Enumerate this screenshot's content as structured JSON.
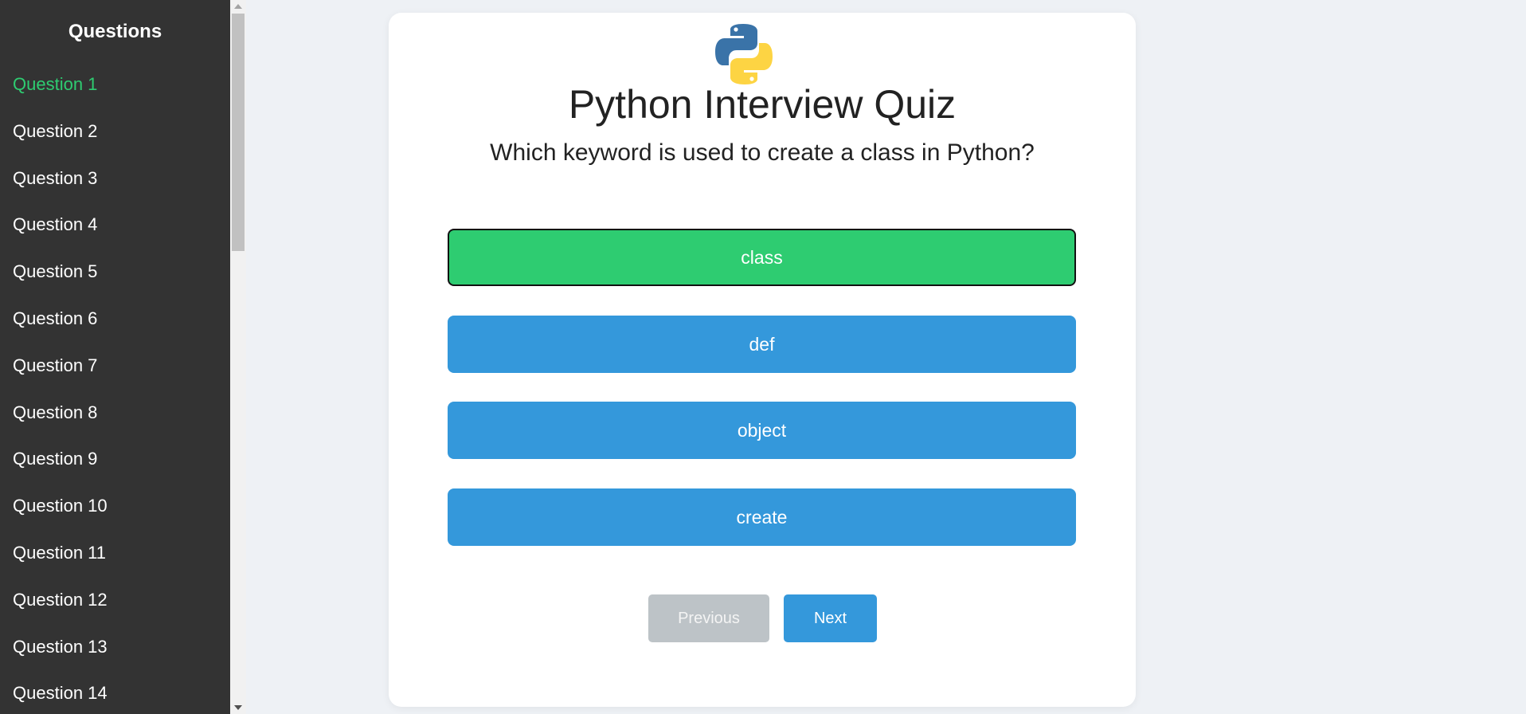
{
  "sidebar": {
    "title": "Questions",
    "active_color": "#2ecc71",
    "items": [
      {
        "label": "Question 1",
        "active": true
      },
      {
        "label": "Question 2"
      },
      {
        "label": "Question 3"
      },
      {
        "label": "Question 4"
      },
      {
        "label": "Question 5"
      },
      {
        "label": "Question 6"
      },
      {
        "label": "Question 7"
      },
      {
        "label": "Question 8"
      },
      {
        "label": "Question 9"
      },
      {
        "label": "Question 10"
      },
      {
        "label": "Question 11"
      },
      {
        "label": "Question 12"
      },
      {
        "label": "Question 13"
      },
      {
        "label": "Question 14"
      }
    ]
  },
  "quiz": {
    "logo_icon": "python-logo-icon",
    "title": "Python Interview Quiz",
    "question": "Which keyword is used to create a class in Python?",
    "options": [
      {
        "label": "class",
        "state": "correct"
      },
      {
        "label": "def",
        "state": "default"
      },
      {
        "label": "object",
        "state": "default"
      },
      {
        "label": "create",
        "state": "default"
      }
    ],
    "colors": {
      "correct": "#2ecc71",
      "default": "#3498db",
      "disabled": "#bdc3c7"
    }
  },
  "nav": {
    "previous_label": "Previous",
    "next_label": "Next"
  }
}
